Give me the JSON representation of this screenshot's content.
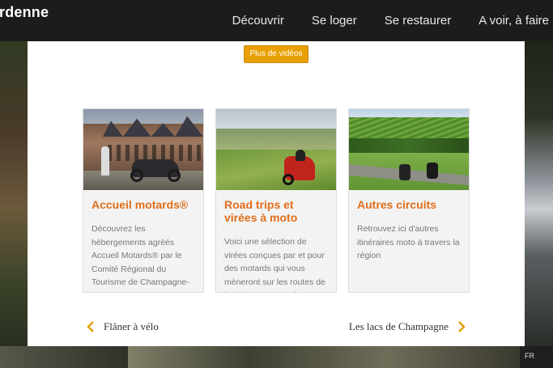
{
  "header": {
    "logo": "rdenne",
    "nav": [
      "Découvrir",
      "Se loger",
      "Se restaurer",
      "A voir, à faire"
    ]
  },
  "panel": {
    "videos_button": "Plus de vidéos",
    "cards": [
      {
        "title": "Accueil motards®",
        "text": "Découvrez les hébergements agréés Accueil Motards® par le Comité Régional du Tourisme de Champagne-Ardenne"
      },
      {
        "title": "Road trips et virées à moto",
        "text": "Voici une sélection de virées conçues par et pour des motards qui vous mèneront sur les routes de la Champagne et des"
      },
      {
        "title": "Autres circuits",
        "text": "Retrouvez ici d'autres itinéraires moto à travers la région"
      }
    ],
    "prev_link": "Flâner à vélo",
    "next_link": "Les lacs de Champagne"
  },
  "language": "FR",
  "colors": {
    "accent_orange": "#e06e1a",
    "button_yellow": "#e8a000",
    "header_bg": "#1c1c1c"
  },
  "icons": {
    "prev": "chevron-left-icon",
    "next": "chevron-right-icon"
  }
}
